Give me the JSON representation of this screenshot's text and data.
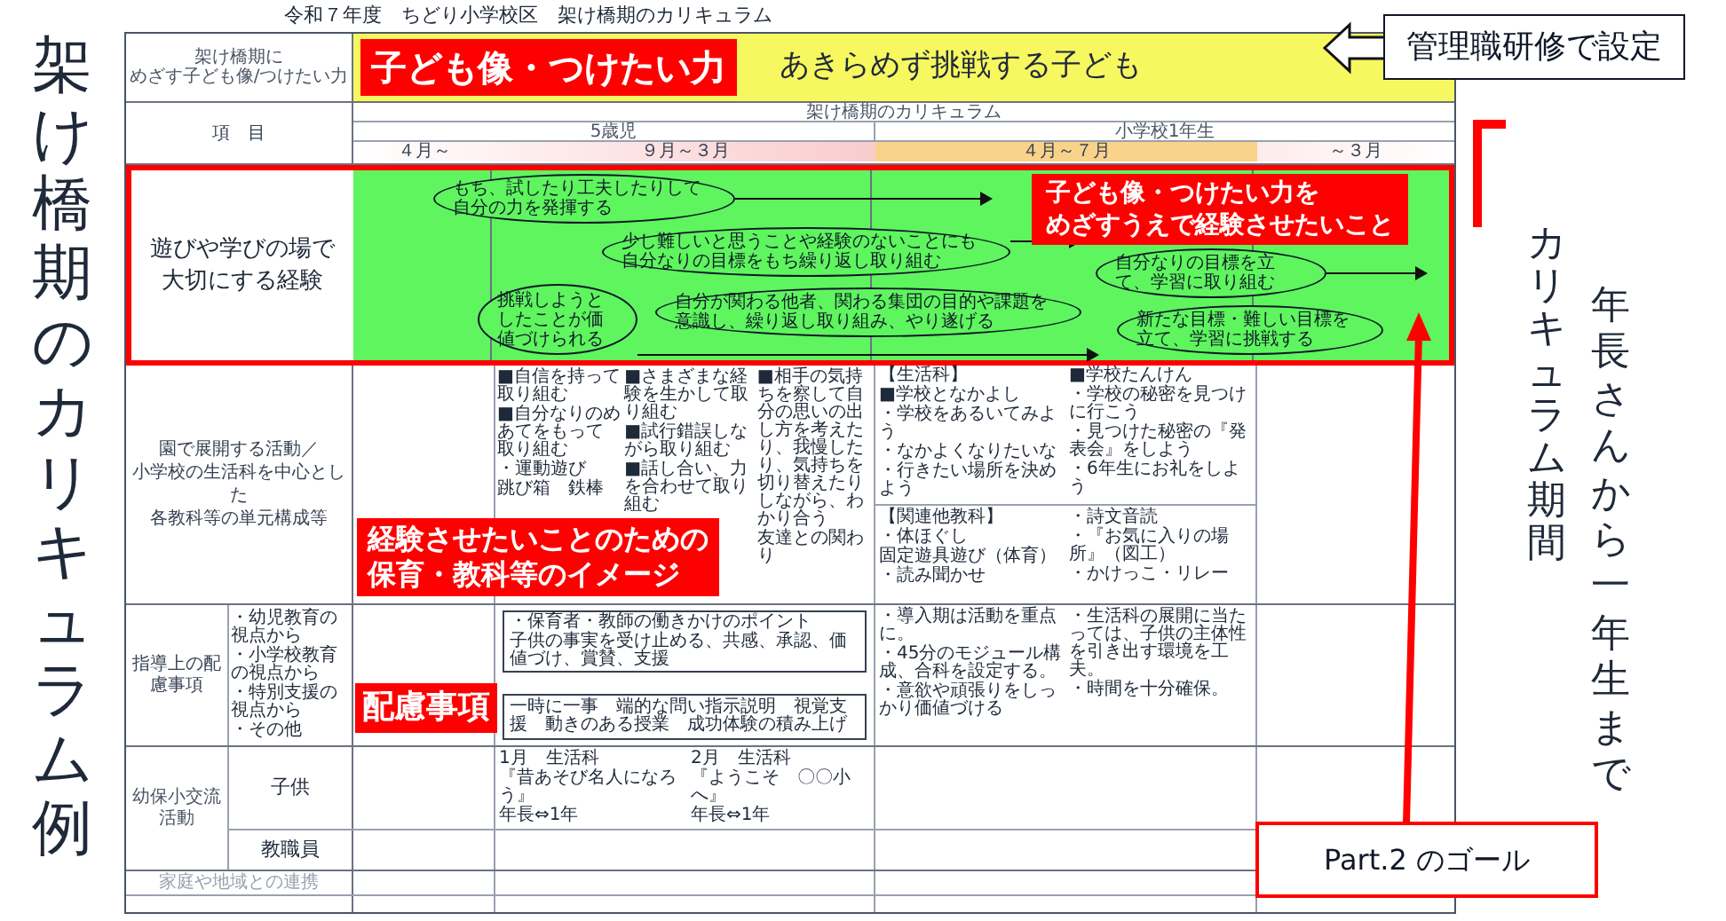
{
  "side_title": "架け橋期のカリキュラム例",
  "document": {
    "title": "令和７年度　ちどり小学校区　架け橋期のカリキュラム",
    "goal_row": {
      "label": [
        "架け橋期に",
        "めざす子ども像/つけたい力"
      ],
      "tag": "子ども像・つけたい力",
      "text": "あきらめず挑戦する子ども"
    },
    "header": {
      "label": "項　目",
      "title": "架け橋期のカリキュラム",
      "stages": [
        "5歳児",
        "小学校1年生"
      ],
      "periods": [
        "４月～",
        "９月～３月",
        "４月～７月",
        "～３月"
      ]
    },
    "experience_row": {
      "label": [
        "遊びや学びの場で",
        "大切にする経験"
      ],
      "tag": [
        "子ども像・つけたい力を",
        "めざすうえで経験させたいこと"
      ],
      "notes": [
        "もち、試したり工夫したりして自分の力を発揮する",
        "少し難しいと思うことや経験のないことにも自分なりの目標をもち繰り返し取り組む",
        "自分なりの目標を立て、学習に取り組む",
        "挑戦しようとしたことが価値づけられる",
        "自分が関わる他者、関わる集団の目的や課題を意識し、繰り返し取り組み、やり遂げる",
        "新たな目標・難しい目標を立て、学習に挑戦する"
      ]
    },
    "activities_row": {
      "label": [
        "園で展開する活動／",
        "小学校の生活科を中心とした",
        "各教科等の単元構成等"
      ],
      "tag": [
        "経験させたいことのための",
        "保育・教科等のイメージ"
      ],
      "kindergarten": [
        [
          "■自信を持って取り組む",
          "■自分なりのめあてをもって取り組む",
          "・運動遊び",
          "跳び箱　鉄棒"
        ],
        [
          "■さまざまな経験を生かして取り組む",
          "■試行錯誤しながら取り組む",
          "■話し合い、力を合わせて取り組む"
        ],
        [
          "■相手の気持ちを察して自分の思いの出し方を考えたり、我慢したり、気持ちを切り替えたりしながら、わかり合う",
          "友達との関わり"
        ]
      ],
      "school_top": [
        [
          "【生活科】",
          "■学校となかよし",
          "・学校をあるいてみよう",
          "・なかよくなりたいな",
          "・行きたい場所を決めよう"
        ],
        [
          "■学校たんけん",
          "・学校の秘密を見つけに行こう",
          "・見つけた秘密の『発表会』をしよう",
          "・6年生にお礼をしよう"
        ]
      ],
      "school_bottom": [
        [
          "【関連他教科】",
          "・体ほぐし",
          "固定遊具遊び（体育）",
          "・読み聞かせ"
        ],
        [
          "・詩文音読",
          "・『お気に入りの場所』（図工）",
          "・かけっこ・リレー"
        ]
      ]
    },
    "care_row": {
      "label": "指導上の配慮事項",
      "viewpoints": [
        "・幼児教育の視点から",
        "・小学校教育の視点から",
        "・特別支援の視点から",
        "・その他"
      ],
      "tag": "配慮事項",
      "point_box": [
        "・保育者・教師の働きかけのポイント",
        "子供の事実を受け止める、共感、承認、価値づけ、賞賛、支援"
      ],
      "school": [
        [
          "・導入期は活動を重点に。",
          "・45分のモジュール構成、合科を設定する。",
          "・意欲や頑張りをしっかり価値づける"
        ],
        [
          "・生活科の展開に当たっては、子供の主体性を引き出す環境を工夫。",
          "・時間を十分確保。"
        ]
      ],
      "bar": "一時に一事　端的な問い指示説明　視覚支援　動きのある授業　成功体験の積み上げ"
    },
    "exchange_row": {
      "label": "幼保小交流活動",
      "rows": [
        {
          "label": "子供",
          "events": [
            [
              "1月　生活科",
              "『昔あそび名人になろう』",
              "年長⇔1年"
            ],
            [
              "2月　生活科",
              "『ようこそ　〇〇小へ』",
              "年長⇔1年"
            ]
          ]
        },
        {
          "label": "教職員"
        }
      ]
    },
    "community_row": {
      "label": "家庭や地域との連携"
    }
  },
  "callout": "管理職研修で設定",
  "period_notes": [
    "カリキュラム期間",
    "年長さんから一年生まで"
  ],
  "goal_box": "Part.2 のゴール"
}
